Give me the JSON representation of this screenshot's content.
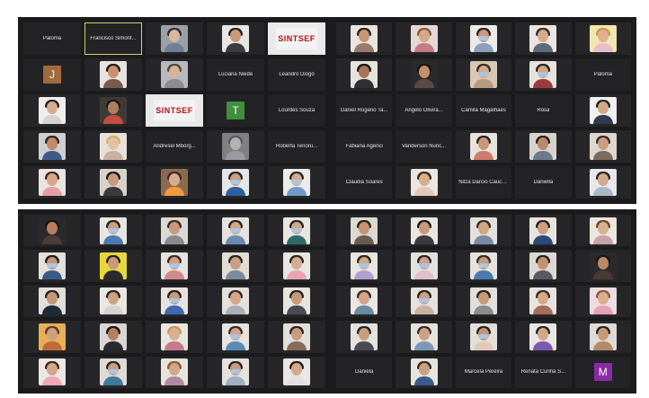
{
  "colors": {
    "panel_bg": "#1b1b1d",
    "tile_bg": "#232326",
    "active_border": "#cfd46a",
    "logo_red": "#b3121c",
    "mask_blue": "#a8c5e6"
  },
  "panels": [
    {
      "id": "top-left",
      "tiles": [
        {
          "type": "name",
          "text": "Paloma"
        },
        {
          "type": "name",
          "text": "Francisco Simonf...",
          "active": true
        },
        {
          "type": "video",
          "skin": "#d8b8a0",
          "bg": "#9aa0a8",
          "hair": "#3b2a22",
          "body": "#6f7f95",
          "mask": false
        },
        {
          "type": "video",
          "skin": "#c89a7a",
          "bg": "#e8e6e2",
          "hair": "#2b2220",
          "body": "#3d3d40",
          "mask": false
        },
        {
          "type": "logo",
          "text": "SINTSEF",
          "bg": "#f2f2f2"
        },
        {
          "type": "avatar",
          "text": "J",
          "color": "#a06b3d"
        },
        {
          "type": "video",
          "skin": "#c99070",
          "bg": "#e6e3df",
          "hair": "#241a16",
          "body": "#7a5a4a",
          "mask": false
        },
        {
          "type": "video",
          "skin": "#d6b49a",
          "bg": "#b7b9be",
          "hair": "#58463b",
          "body": "#8a8c91",
          "mask": false
        },
        {
          "type": "name",
          "text": "Luciana Neide"
        },
        {
          "type": "name",
          "text": "Leandro Diogo"
        },
        {
          "type": "video",
          "skin": "#d4ad90",
          "bg": "#f0eeec",
          "hair": "#2a2220",
          "body": "#d7d4d0",
          "mask": false
        },
        {
          "type": "video",
          "skin": "#b17e5d",
          "bg": "#3e3a37",
          "hair": "#1f1a18",
          "body": "#c44e43",
          "mask": false
        },
        {
          "type": "logo",
          "text": "SINTSEF",
          "bg": "#f2f2f2"
        },
        {
          "type": "avatar",
          "text": "T",
          "color": "#3f8f3f"
        },
        {
          "type": "name",
          "text": "Lourdes Souza"
        },
        {
          "type": "video",
          "skin": "#c08a68",
          "bg": "#cfcfd2",
          "hair": "#2c2420",
          "body": "#3d5b8a",
          "mask": false
        },
        {
          "type": "video",
          "skin": "#e2c2a4",
          "bg": "#e7e1dc",
          "hair": "#d1b06b",
          "body": "#c9b0a0",
          "mask": false
        },
        {
          "type": "name",
          "text": "Andresel Mborg..."
        },
        {
          "type": "video",
          "skin": "#b8b2ad",
          "bg": "#7f7f84",
          "hair": "#5a5a5e",
          "body": "#9a9aa0",
          "mask": false
        },
        {
          "type": "name",
          "text": "Roberta Tenoru..."
        },
        {
          "type": "video",
          "skin": "#d7a98a",
          "bg": "#e9e4df",
          "hair": "#3a2a22",
          "body": "#e4a0a8",
          "mask": false
        },
        {
          "type": "video",
          "skin": "#c69a7c",
          "bg": "#d8d2cc",
          "hair": "#1e1816",
          "body": "#3a3a3c",
          "mask": false
        },
        {
          "type": "video",
          "skin": "#d8ad8e",
          "bg": "#8c6a50",
          "hair": "#3a2a20",
          "body": "#f09a3e",
          "mask": false
        },
        {
          "type": "video",
          "skin": "#c9a083",
          "bg": "#e5e5e8",
          "hair": "#2a2420",
          "body": "#2f5fa0",
          "mask": true
        },
        {
          "type": "video",
          "skin": "#d2ab8e",
          "bg": "#ecebe8",
          "hair": "#2e2622",
          "body": "#6f9acb",
          "mask": true
        }
      ]
    },
    {
      "id": "top-right",
      "tiles": [
        {
          "type": "video",
          "skin": "#c49676",
          "bg": "#e8e4df",
          "hair": "#2c221e",
          "body": "#9a7b6a",
          "mask": false
        },
        {
          "type": "video",
          "skin": "#d5a888",
          "bg": "#e4d8d2",
          "hair": "#8a5a3a",
          "body": "#c47b84",
          "mask": false
        },
        {
          "type": "video",
          "skin": "#c99a7a",
          "bg": "#edeae6",
          "hair": "#2a201c",
          "body": "#8aa0c0",
          "mask": true
        },
        {
          "type": "video",
          "skin": "#d2aa8c",
          "bg": "#e9e5e1",
          "hair": "#3a2c24",
          "body": "#5f6a7a",
          "mask": false
        },
        {
          "type": "video",
          "skin": "#e0b08a",
          "bg": "#f0e6b0",
          "hair": "#c89b4b",
          "body": "#e6c0c8",
          "mask": false
        },
        {
          "type": "video",
          "skin": "#a87656",
          "bg": "#e6e2de",
          "hair": "#1b1412",
          "body": "#2f2f33",
          "mask": false
        },
        {
          "type": "video",
          "skin": "#c48e6d",
          "bg": "#2a2a2d",
          "hair": "#1a1412",
          "body": "#5a4a44",
          "mask": false
        },
        {
          "type": "video",
          "skin": "#d4aa8c",
          "bg": "#d8c7b4",
          "hair": "#3a2a20",
          "body": "#b59a80",
          "mask": true
        },
        {
          "type": "video",
          "skin": "#d0a484",
          "bg": "#e5e2df",
          "hair": "#2a221e",
          "body": "#9b3c3c",
          "mask": true
        },
        {
          "type": "name",
          "text": "Paloma"
        },
        {
          "type": "name",
          "text": "Daniel Rogerio Ta..."
        },
        {
          "type": "name",
          "text": "Angelo Olivira..."
        },
        {
          "type": "name",
          "text": "Camila Magalhaes"
        },
        {
          "type": "name",
          "text": "Rosa"
        },
        {
          "type": "video",
          "skin": "#d2a888",
          "bg": "#f0f0f2",
          "hair": "#2a221c",
          "body": "#2f3a50",
          "mask": false
        },
        {
          "type": "name",
          "text": "Fabiana Agenci"
        },
        {
          "type": "name",
          "text": "Vanderson Nunc..."
        },
        {
          "type": "video",
          "skin": "#c99878",
          "bg": "#e7e2dc",
          "hair": "#2c221d",
          "body": "#d07a6a",
          "mask": false
        },
        {
          "type": "video",
          "skin": "#b98a6a",
          "bg": "#d7d4cf",
          "hair": "#2a201b",
          "body": "#6c7a8c",
          "mask": false
        },
        {
          "type": "video",
          "skin": "#caa080",
          "bg": "#ddd7d1",
          "hair": "#3a2c24",
          "body": "#7a6a60",
          "mask": false
        },
        {
          "type": "name",
          "text": "Claudia Soares"
        },
        {
          "type": "video",
          "skin": "#d6ae90",
          "bg": "#ebe6e0",
          "hair": "#3c2a20",
          "body": "#e2c8b8",
          "mask": false
        },
        {
          "type": "name",
          "text": "Nilza Darcio Cauculo de Sarguenta"
        },
        {
          "type": "name",
          "text": "Daniella"
        },
        {
          "type": "video",
          "skin": "#d1ab90",
          "bg": "#e8e8ea",
          "hair": "#2c2420",
          "body": "#aab8c8",
          "mask": false
        }
      ]
    },
    {
      "id": "bottom-left",
      "tiles": [
        {
          "type": "video",
          "skin": "#b8805e",
          "bg": "#2a2a2d",
          "hair": "#1a1412",
          "body": "#4a3c36",
          "mask": false
        },
        {
          "type": "video",
          "skin": "#c9a084",
          "bg": "#e8e6e3",
          "hair": "#2a221e",
          "body": "#4a7ab0",
          "mask": true
        },
        {
          "type": "video",
          "skin": "#c69a7a",
          "bg": "#dcd8d3",
          "hair": "#3a2a22",
          "body": "#8a8a8e",
          "mask": false
        },
        {
          "type": "video",
          "skin": "#cfa686",
          "bg": "#e4e2de",
          "hair": "#2c2420",
          "body": "#6a8ab0",
          "mask": true
        },
        {
          "type": "video",
          "skin": "#d4aa8c",
          "bg": "#e9e6e2",
          "hair": "#2a221c",
          "body": "#2e6a6a",
          "mask": true
        },
        {
          "type": "video",
          "skin": "#c49676",
          "bg": "#e3e0dc",
          "hair": "#1e1816",
          "body": "#3a5a8a",
          "mask": true
        },
        {
          "type": "video",
          "skin": "#c89a7a",
          "bg": "#e8d83a",
          "hair": "#2a201c",
          "body": "#2a2a2e",
          "mask": false
        },
        {
          "type": "video",
          "skin": "#d0a080",
          "bg": "#e6e3df",
          "hair": "#3a2c24",
          "body": "#d08a8a",
          "mask": true
        },
        {
          "type": "video",
          "skin": "#c9a084",
          "bg": "#e0dcd6",
          "hair": "#2a221e",
          "body": "#7a8a9a",
          "mask": false
        },
        {
          "type": "video",
          "skin": "#d4ae90",
          "bg": "#e9e6e2",
          "hair": "#2c241e",
          "body": "#e8a4b0",
          "mask": false
        },
        {
          "type": "video",
          "skin": "#c39878",
          "bg": "#e2dfdb",
          "hair": "#2a2220",
          "body": "#1e2a3a",
          "mask": false
        },
        {
          "type": "video",
          "skin": "#cca283",
          "bg": "#ebe8e4",
          "hair": "#2c221e",
          "body": "#d6d2ce",
          "mask": false
        },
        {
          "type": "video",
          "skin": "#c89a7c",
          "bg": "#e6e3df",
          "hair": "#2a201c",
          "body": "#3a6ab0",
          "mask": true
        },
        {
          "type": "video",
          "skin": "#d2a888",
          "bg": "#e4e1dd",
          "hair": "#3a2a22",
          "body": "#aab0b8",
          "mask": false
        },
        {
          "type": "video",
          "skin": "#c59a7a",
          "bg": "#e7e4e0",
          "hair": "#2a221e",
          "body": "#4a4a50",
          "mask": false
        },
        {
          "type": "video",
          "skin": "#caa080",
          "bg": "#e5b058",
          "hair": "#5a3a22",
          "body": "#c06a3a",
          "mask": false
        },
        {
          "type": "video",
          "skin": "#b48060",
          "bg": "#d8d6d2",
          "hair": "#1a1412",
          "body": "#2a2a2e",
          "mask": false
        },
        {
          "type": "video",
          "skin": "#d8b090",
          "bg": "#e9e6e2",
          "hair": "#c89a5a",
          "body": "#c87a8a",
          "mask": false
        },
        {
          "type": "video",
          "skin": "#d0a686",
          "bg": "#e6e4e0",
          "hair": "#3a2a22",
          "body": "#5a8ab8",
          "mask": true
        },
        {
          "type": "video",
          "skin": "#c99c7c",
          "bg": "#e2dfdb",
          "hair": "#2c241e",
          "body": "#8a6a5a",
          "mask": false
        },
        {
          "type": "video",
          "skin": "#d2a888",
          "bg": "#ebe8e4",
          "hair": "#3a2a20",
          "body": "#f0a6b6",
          "mask": false
        },
        {
          "type": "video",
          "skin": "#c9a084",
          "bg": "#dedad6",
          "hair": "#2a221e",
          "body": "#3a7a9a",
          "mask": true
        },
        {
          "type": "video",
          "skin": "#d0a888",
          "bg": "#e7e4e0",
          "hair": "#8a5a3a",
          "body": "#b08aa0",
          "mask": false
        },
        {
          "type": "video",
          "skin": "#c89c80",
          "bg": "#e4e2de",
          "hair": "#2c241e",
          "body": "#a0b0c0",
          "mask": true
        },
        {
          "type": "video",
          "skin": "#d4aa8c",
          "bg": "#e9e6e3",
          "hair": "#2a201c",
          "body": "#e0e0e4",
          "mask": false
        }
      ]
    },
    {
      "id": "bottom-right",
      "tiles": [
        {
          "type": "video",
          "skin": "#c49474",
          "bg": "#dcd8d2",
          "hair": "#2a221c",
          "body": "#6a5a50",
          "mask": false
        },
        {
          "type": "video",
          "skin": "#c89a7a",
          "bg": "#e9e6e2",
          "hair": "#1e1816",
          "body": "#3a3a40",
          "mask": false
        },
        {
          "type": "video",
          "skin": "#d0a686",
          "bg": "#e4e1dd",
          "hair": "#3a2c24",
          "body": "#7a8aa0",
          "mask": false
        },
        {
          "type": "video",
          "skin": "#caa080",
          "bg": "#e7e4e0",
          "hair": "#2a221e",
          "body": "#2a4a7a",
          "mask": false
        },
        {
          "type": "video",
          "skin": "#d8ae8e",
          "bg": "#ebe6e0",
          "hair": "#6a4a30",
          "body": "#c8a0a8",
          "mask": false
        },
        {
          "type": "video",
          "skin": "#d2a888",
          "bg": "#e8e6e3",
          "hair": "#2c241e",
          "body": "#b0a0d0",
          "mask": true
        },
        {
          "type": "video",
          "skin": "#caa284",
          "bg": "#e4e2de",
          "hair": "#2a221e",
          "body": "#e0c0c8",
          "mask": true
        },
        {
          "type": "video",
          "skin": "#c89c7c",
          "bg": "#e6e3df",
          "hair": "#3a2a22",
          "body": "#4a7ab0",
          "mask": true
        },
        {
          "type": "video",
          "skin": "#c29272",
          "bg": "#dcd8d4",
          "hair": "#2a201c",
          "body": "#5a5a60",
          "mask": false
        },
        {
          "type": "video",
          "skin": "#b98a6a",
          "bg": "#2a2a2d",
          "hair": "#1a1412",
          "body": "#4a3a34",
          "mask": false
        },
        {
          "type": "video",
          "skin": "#d0a686",
          "bg": "#e9e6e3",
          "hair": "#3a2a22",
          "body": "#6a8aa0",
          "mask": false
        },
        {
          "type": "video",
          "skin": "#cca282",
          "bg": "#e5e2de",
          "hair": "#2a221e",
          "body": "#c9b2a0",
          "mask": true
        },
        {
          "type": "video",
          "skin": "#c89a7a",
          "bg": "#e2dfdb",
          "hair": "#2c241e",
          "body": "#8a8a90",
          "mask": false
        },
        {
          "type": "video",
          "skin": "#d2aa8a",
          "bg": "#e7e4e0",
          "hair": "#3a2a20",
          "body": "#a86a5a",
          "mask": false
        },
        {
          "type": "video",
          "skin": "#d8ae8e",
          "bg": "#ecdde2",
          "hair": "#8a5a3a",
          "body": "#e8a0b4",
          "mask": false
        },
        {
          "type": "video",
          "skin": "#c99c7c",
          "bg": "#e4e2de",
          "hair": "#2a221e",
          "body": "#4a4a50",
          "mask": false
        },
        {
          "type": "video",
          "skin": "#cca284",
          "bg": "#e6e3df",
          "hair": "#3a2c24",
          "body": "#7a9ab8",
          "mask": false
        },
        {
          "type": "video",
          "skin": "#c69676",
          "bg": "#e2dfdb",
          "hair": "#2a201c",
          "body": "#e2c8b8",
          "mask": true
        },
        {
          "type": "video",
          "skin": "#d0a888",
          "bg": "#e9e6e3",
          "hair": "#2c241e",
          "body": "#7a5ab0",
          "mask": false
        },
        {
          "type": "video",
          "skin": "#c89a7a",
          "bg": "#dedad6",
          "hair": "#2a221e",
          "body": "#b08a6a",
          "mask": false
        },
        {
          "type": "name",
          "text": "Daniela"
        },
        {
          "type": "video",
          "skin": "#caa080",
          "bg": "#e7e4e0",
          "hair": "#3a2a22",
          "body": "#3a5a8a",
          "mask": false
        },
        {
          "type": "name",
          "text": "Marcela Pereira"
        },
        {
          "type": "name",
          "text": "Renata Cunha S..."
        },
        {
          "type": "avatar",
          "text": "M",
          "color": "#8a2aa8"
        }
      ]
    }
  ]
}
